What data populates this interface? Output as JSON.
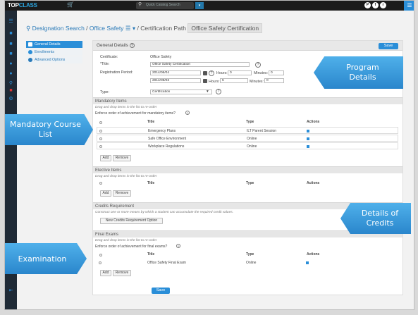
{
  "topbar": {
    "logo_a": "TOP",
    "logo_b": "CLASS",
    "cart_icon": "shopping-cart-icon",
    "search_placeholder": "Quick Catalog Search",
    "social": [
      "P",
      "f",
      "r"
    ],
    "menu_icon": "hamburger-menu-icon"
  },
  "breadcrumb": {
    "root": "Designation Search",
    "sep1": "/",
    "middle": "Office Safety",
    "sep2": "/",
    "path": "Certification Path",
    "current": "Office Safety Certification"
  },
  "left_tabs": [
    {
      "label": "General Details",
      "icon": "list-icon"
    },
    {
      "label": "Enrollments",
      "icon": "users-icon"
    },
    {
      "label": "Advanced Options",
      "icon": "gear-icon"
    }
  ],
  "general": {
    "header": "General Details",
    "help": "?",
    "save_label": "Save",
    "certificate_label": "Certificate:",
    "certificate_value": "Office Safety",
    "title_label": "*Title:",
    "title_value": "Office Safety Certification",
    "reg_label": "Registration Period:",
    "date1": "2014/06/04",
    "date2": "2014/09/03",
    "hours_label": "Hours:",
    "hours1": "0",
    "hours2": "5",
    "minutes_label": "Minutes:",
    "minutes1": "0",
    "minutes2": "0",
    "type_label": "Type:",
    "type_value": "Certification"
  },
  "mandatory": {
    "header": "Mandatory Items",
    "note": "Drag and drop items in the list to re-order",
    "enforce": "Enforce order of achievement for mandatory items?",
    "col_title": "Title",
    "col_type": "Type",
    "col_actions": "Actions",
    "rows": [
      {
        "title": "Emergency Plans",
        "type": "ILT Parent Session"
      },
      {
        "title": "Safe Office Environment",
        "type": "Online"
      },
      {
        "title": "Workplace Regulations",
        "type": "Online"
      }
    ],
    "add": "Add",
    "remove": "Remove"
  },
  "elective": {
    "header": "Elective Items",
    "note": "Drag and drop items in the list to re-order",
    "col_title": "Title",
    "col_type": "Type",
    "col_actions": "Actions",
    "add": "Add",
    "remove": "Remove"
  },
  "credits": {
    "header": "Credits Requirement",
    "note": "Construct one or more means by which a student can accumulate the required credit values.",
    "new_option": "New Credits Requirement Option"
  },
  "finals": {
    "header": "Final Exams",
    "note": "Drag and drop items in the list to re-order",
    "enforce": "Enforce order of achievement for final exams?",
    "col_title": "Title",
    "col_type": "Type",
    "col_actions": "Actions",
    "rows": [
      {
        "title": "Office Safety Final Exam",
        "type": "Online"
      }
    ],
    "add": "Add",
    "remove": "Remove"
  },
  "bottom_save": "Save",
  "callouts": {
    "program_l1": "Program",
    "program_l2": "Details",
    "mandatory_l1": "Mandatory Course",
    "mandatory_l2": "List",
    "credits_l1": "Details of",
    "credits_l2": "Credits",
    "exam": "Examination"
  },
  "colors": {
    "accent": "#2a8ed8",
    "callout_top": "#4fb0ea",
    "callout_bottom": "#2a86cc",
    "topbar": "#1b1b1b",
    "rail": "#1f2a36"
  }
}
